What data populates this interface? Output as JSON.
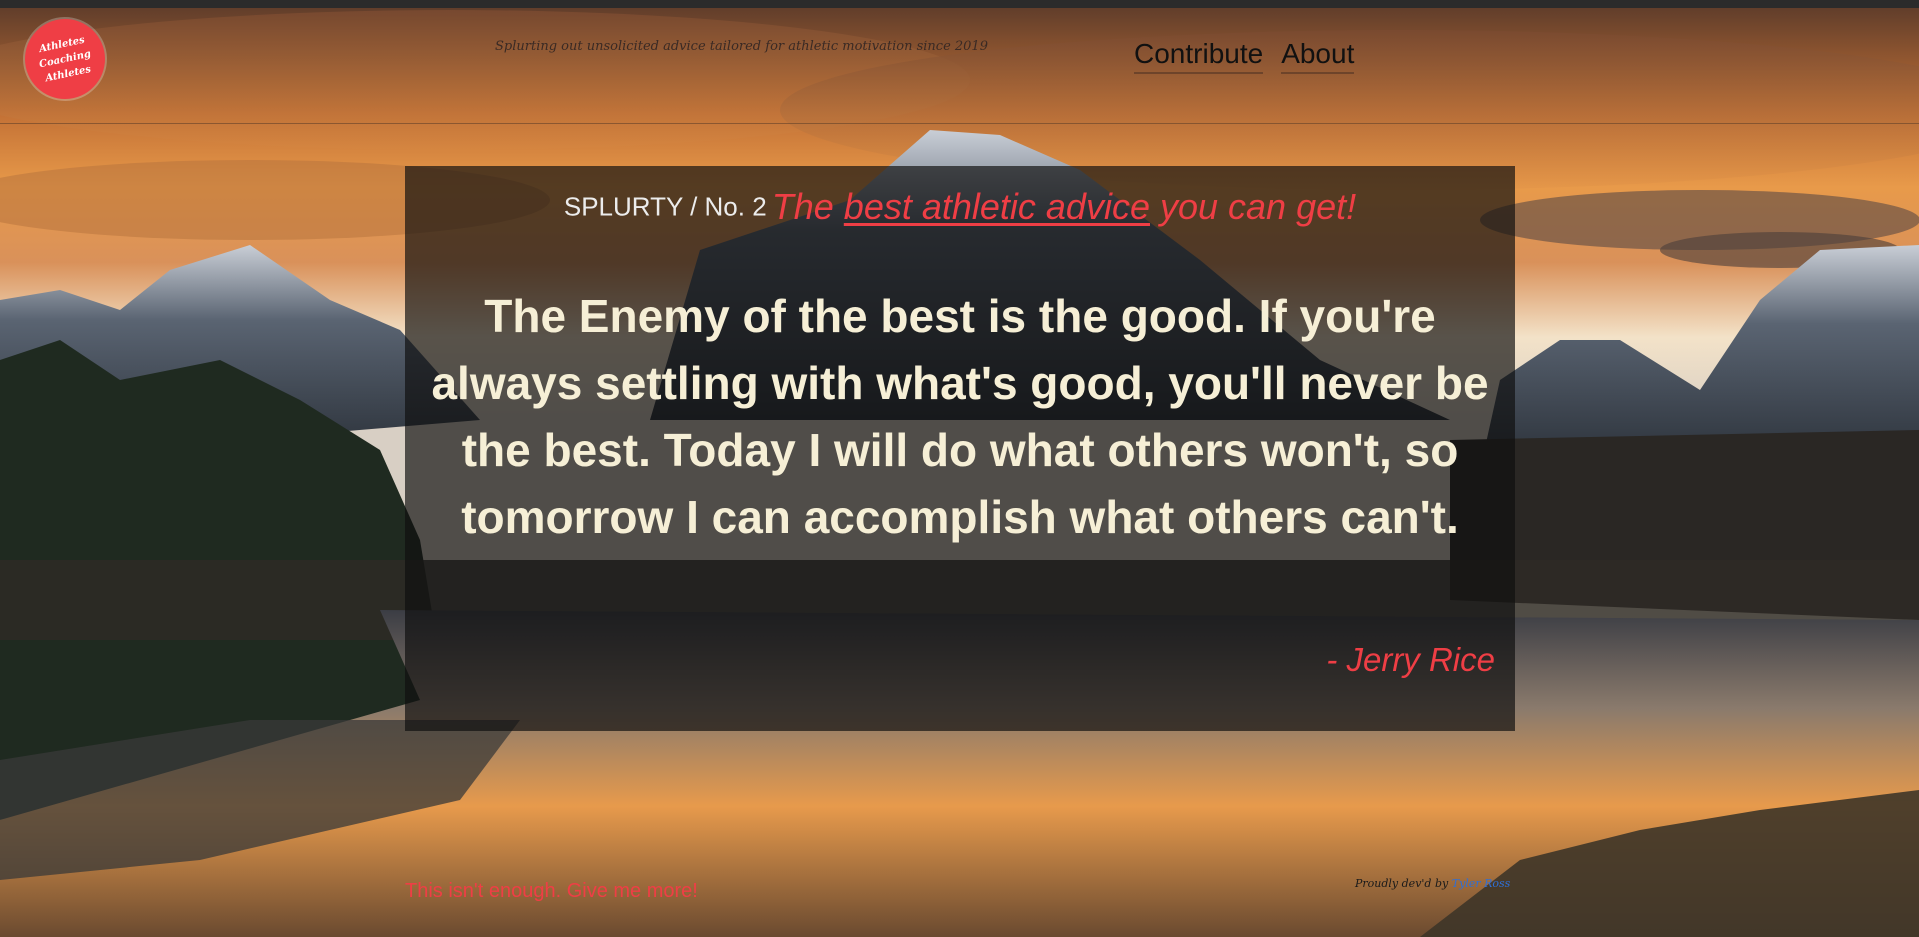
{
  "header": {
    "logo_lines": [
      "Athletes",
      "Coaching",
      "Athletes"
    ],
    "tagline": "Splurting out unsolicited advice tailored for athletic motivation since 2019",
    "nav": {
      "contribute": "Contribute",
      "about": "About"
    }
  },
  "card": {
    "brand": "SPLURTY / No. 2",
    "tag_prefix": "The ",
    "tag_underlined": "best athletic advice",
    "tag_suffix": " you can get!",
    "quote": "The Enemy of the best is the good. If you're always settling with what's good, you'll never be the best. Today I will do what others won't, so tomorrow I can accomplish what others can't.",
    "author": "- Jerry Rice"
  },
  "footer": {
    "more_link": "This isn't enough. Give me more!",
    "credit_prefix": "Proudly dev'd by",
    "credit_name": "Tyler Ross"
  },
  "colors": {
    "accent": "#ef3e45",
    "quote_text": "#f6efd6",
    "card_bg": "rgba(15,15,15,0.68)"
  },
  "icons": {
    "logo": "logo-badge-icon"
  }
}
